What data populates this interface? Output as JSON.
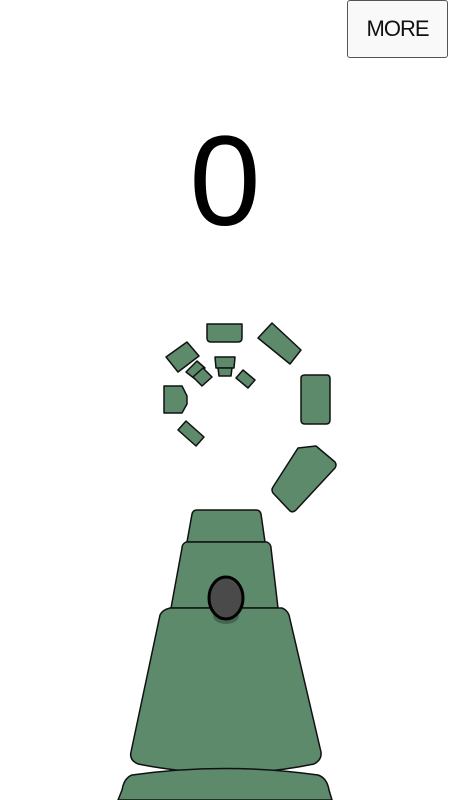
{
  "hud": {
    "more_label": "MORE",
    "score": "0"
  },
  "colors": {
    "tile_fill": "#5c8a6b",
    "tile_stroke": "#111111",
    "ball_fill": "#4a4a4a",
    "background": "#ffffff"
  },
  "icons": {
    "player": "ball-icon"
  }
}
